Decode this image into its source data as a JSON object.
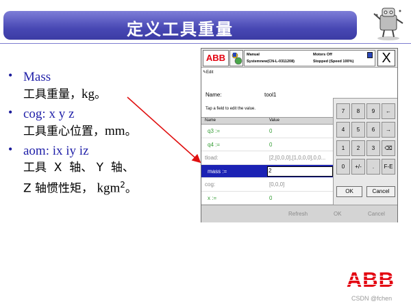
{
  "slide": {
    "title": "定义工具重量",
    "footer": "CSDN @fchen"
  },
  "bullets": [
    {
      "head": "Mass",
      "line1_cn": "工具重量，",
      "line1_latin": "kg",
      "line1_end": "。"
    },
    {
      "head": "cog: x y z",
      "line1_cn": "工具重心位置，",
      "line1_latin": "mm",
      "line1_end": "。"
    },
    {
      "head": "aom: ix iy iz",
      "line1": "工具  X  轴、 Y  轴、",
      "line2_cn": "Z 轴惯性矩，",
      "line2_latin": "kgm",
      "line2_sup": "2",
      "line2_end": "。"
    }
  ],
  "pendant": {
    "abb_label": "ABB",
    "status": {
      "mode": "Manual",
      "system": "Systemnew(CN-L-0311208)",
      "motors": "Motors Off",
      "state": "Stopped (Speed 100%)"
    },
    "close_label": "X",
    "edit_label": "Edit",
    "name_label": "Name:",
    "name_value": "tool1",
    "hint": "Tap a field to edit the value.",
    "columns": [
      "Name",
      "Value"
    ],
    "rows": [
      {
        "name": "q3 :=",
        "value": "0",
        "style": "green"
      },
      {
        "name": "q4 :=",
        "value": "0",
        "style": "green"
      },
      {
        "name": "tload:",
        "value": "[2,[0,0,0],[1,0,0,0],0,0...",
        "style": "gray"
      },
      {
        "name": "mass :=",
        "value": "2",
        "style": "selected"
      },
      {
        "name": "cog:",
        "value": "[0,0,0]",
        "style": "gray"
      },
      {
        "name": "x :=",
        "value": "0",
        "style": "green"
      }
    ],
    "keypad": {
      "keys": [
        [
          "7",
          "8",
          "9",
          "←"
        ],
        [
          "4",
          "5",
          "6",
          "→"
        ],
        [
          "1",
          "2",
          "3",
          "⌫"
        ],
        [
          "0",
          "+/-",
          ".",
          "F-E"
        ]
      ],
      "ok": "OK",
      "cancel": "Cancel"
    },
    "bottom": {
      "refresh": "Refresh",
      "ok": "OK",
      "cancel": "Cancel"
    }
  },
  "brand": {
    "logo_text": "ABB",
    "logo_color": "#e3000f",
    "accent": "#4848b4"
  }
}
